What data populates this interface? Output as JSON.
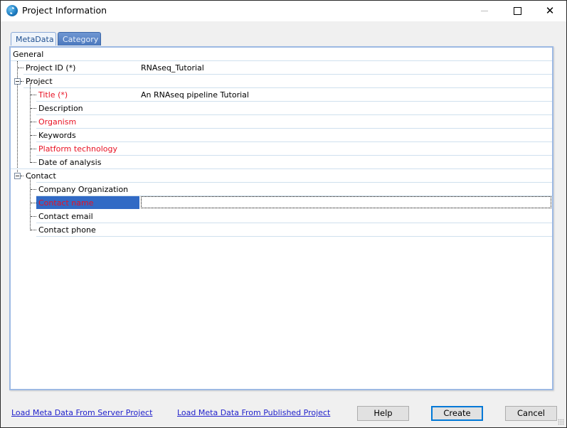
{
  "window": {
    "title": "Project Information",
    "icon": "app-logo-icon",
    "controls": {
      "minimize": "minimize-icon",
      "maximize": "maximize-icon",
      "close": "close-icon"
    }
  },
  "tabs": [
    {
      "label": "MetaData",
      "active": true
    },
    {
      "label": "Category",
      "active": false
    }
  ],
  "tree": {
    "general": {
      "label": "General"
    },
    "project_id": {
      "label": "Project ID (*)",
      "value": "RNAseq_Tutorial",
      "required": true
    },
    "project": {
      "label": "Project",
      "expanded": true,
      "children": [
        {
          "label": "Title (*)",
          "value": "An RNAseq pipeline Tutorial",
          "highlight": true
        },
        {
          "label": "Description",
          "value": ""
        },
        {
          "label": "Organism",
          "value": "",
          "highlight": true
        },
        {
          "label": "Keywords",
          "value": ""
        },
        {
          "label": "Platform technology",
          "value": "",
          "highlight": true
        },
        {
          "label": "Date of analysis",
          "value": ""
        }
      ]
    },
    "contact": {
      "label": "Contact",
      "expanded": true,
      "children": [
        {
          "label": "Company Organization",
          "value": ""
        },
        {
          "label": "Contact name",
          "value": "",
          "highlight": true,
          "selected": true
        },
        {
          "label": "Contact email",
          "value": ""
        },
        {
          "label": "Contact phone",
          "value": ""
        }
      ]
    }
  },
  "footer": {
    "link_server": "Load Meta Data From Server Project",
    "link_published": "Load Meta Data From Published Project",
    "help": "Help",
    "create": "Create",
    "cancel": "Cancel"
  },
  "colors": {
    "required_text": "#e81123",
    "selection": "#316ac5",
    "link": "#2222cc",
    "default_button_border": "#0078d7"
  }
}
